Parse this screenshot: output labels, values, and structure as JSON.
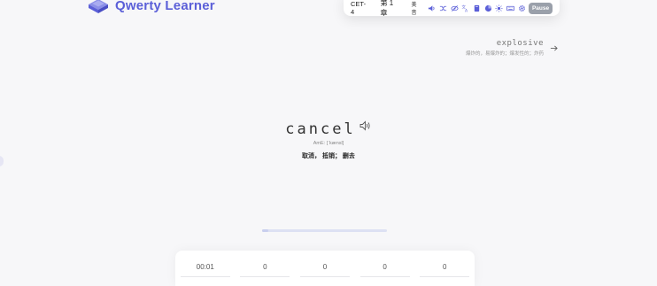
{
  "app": {
    "name": "Qwerty Learner"
  },
  "toolbar": {
    "dictionary": "CET-4",
    "chapter": "第 1 章",
    "accent": "美音",
    "pause_label": "Pause",
    "icons": [
      "sound-icon",
      "shuffle-icon",
      "hide-icon",
      "translate-icon",
      "book-icon",
      "stats-icon",
      "sun-icon",
      "keyboard-icon",
      "settings-icon"
    ]
  },
  "next_word": {
    "word": "explosive",
    "translation": "爆炸的，易爆炸的；爆发性的；炸药"
  },
  "current_word": {
    "word": "cancel",
    "phonetic": "AmE: [ˈkænsl]",
    "translation": "取消，  抵销； 删去"
  },
  "progress": {
    "fraction": 0.05
  },
  "stats": [
    {
      "value": "00:01"
    },
    {
      "value": "0"
    },
    {
      "value": "0"
    },
    {
      "value": "0"
    },
    {
      "value": "0"
    }
  ],
  "colors": {
    "accent": "#5b5fd8",
    "pause_button": "#9aa0aa"
  }
}
